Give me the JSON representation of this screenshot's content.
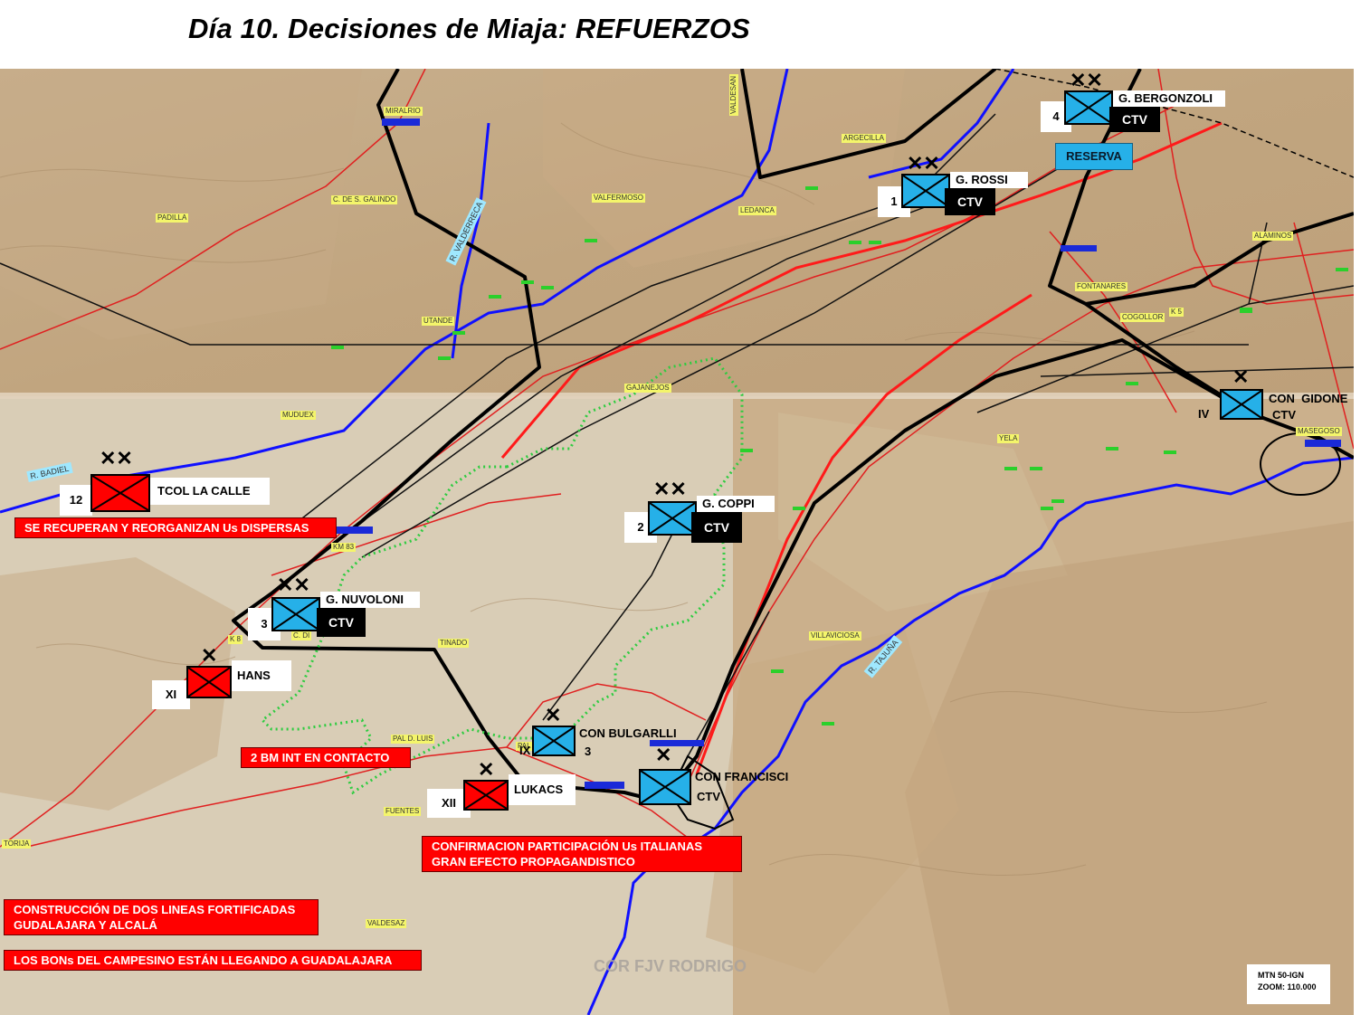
{
  "title": "Día 10. Decisiones de Miaja: REFUERZOS",
  "colors": {
    "republican": "#ff0000",
    "italian": "#26b0e8",
    "road": "#e02020",
    "river": "#1010ff"
  },
  "units": {
    "bergonzoli": {
      "name": "G. BERGONZOLI",
      "number": "4",
      "type": "CTV",
      "echelon": "XX"
    },
    "rossi": {
      "name": "G. ROSSI",
      "number": "1",
      "type": "CTV",
      "echelon": "XX"
    },
    "coppi": {
      "name": "G. COPPI",
      "number": "2",
      "type": "CTV",
      "echelon": "XX"
    },
    "nuvoloni": {
      "name": "G. NUVOLONI",
      "number": "3",
      "type": "CTV",
      "echelon": "XX"
    },
    "gidone": {
      "name": "CON  GIDONE",
      "number": "IV",
      "type": "CTV",
      "echelon": "X"
    },
    "bulgarlli": {
      "name": "CON BULGARLLI",
      "number": "IX",
      "extra": "3",
      "echelon": "X"
    },
    "francisci": {
      "name": "CON FRANCISCI",
      "type": "CTV",
      "echelon": "X"
    },
    "lacalle": {
      "name": "TCOL LA CALLE",
      "number": "12",
      "echelon": "XX"
    },
    "hans": {
      "name": "HANS",
      "number": "XI",
      "echelon": "X"
    },
    "lukacs": {
      "name": "LUKACS",
      "number": "XII",
      "echelon": "X"
    }
  },
  "reserve_label": "RESERVA",
  "notes": {
    "reorganize": "SE RECUPERAN Y REORGANIZAN  Us DISPERSAS",
    "contact": "2 BM INT EN CONTACTO",
    "confirm_1": "CONFIRMACION  PARTICIPACIÓN  Us ITALIANAS",
    "confirm_2": "GRAN EFECTO PROPAGANDISTICO",
    "fortify_1": "CONSTRUCCIÓN DE DOS LINEAS FORTIFICADAS",
    "fortify_2": "GUDALAJARA Y ALCALÁ",
    "campesino": "LOS BONs DEL CAMPESINO ESTÁN LLEGANDO A GUADALAJARA"
  },
  "places": {
    "miralrio": "MIRALRIO",
    "argecilla": "ARGECILLA",
    "galindo": "C. DE S. GALINDO",
    "valfermoso": "VALFERMOSO",
    "ledanca": "LEDANCA",
    "padilla": "PADILLA",
    "utande": "UTANDE",
    "gajanejos": "GAJANEJOS",
    "muduex": "MUDUEX",
    "alaminos": "ALAMINOS",
    "fontanares": "FONTANARES",
    "cogollor": "COGOLLOR",
    "ks": "K 5",
    "yela": "YELA",
    "masegoso": "MASEGOSO",
    "km83": "KM 83",
    "k8": "K 8",
    "tinado": "TINADO",
    "villaviciosa": "VILLAVICIOSA",
    "palarra": "PAL D. ARRA",
    "palluis": "PAL D. LUIS",
    "fuentes": "FUENTES",
    "torija": "TORIJA",
    "valdesaz": "VALDESAZ",
    "valdesa": "VALDESAN",
    "cdi": "C. DI"
  },
  "rivers": {
    "badiel": "R. BADIEL",
    "valderrebollo": "R. VALDERRECA",
    "tajuna": "R. TAJUÑA"
  },
  "watermark": "COR FJV RODRIGO",
  "scale_1": "MTN 50-IGN",
  "scale_2": "ZOOM: 110.000"
}
